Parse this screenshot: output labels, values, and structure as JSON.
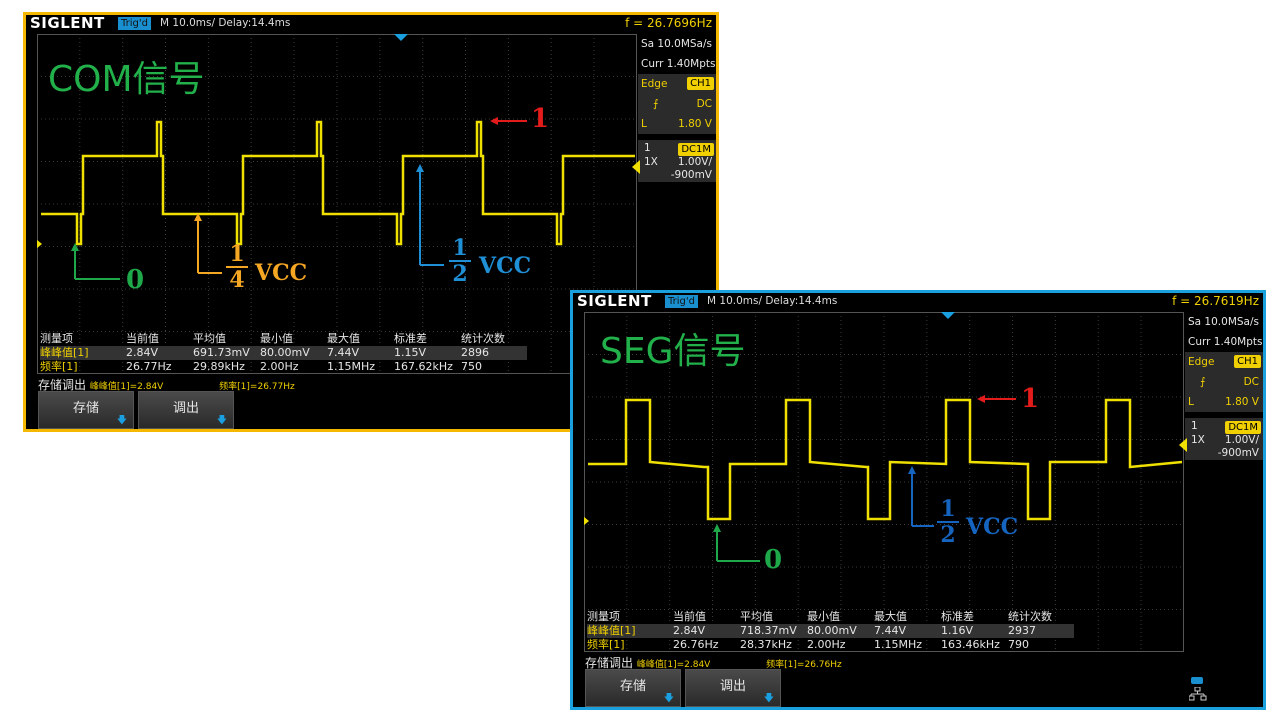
{
  "scopes": [
    {
      "logo": "SIGLENT",
      "trig_status": "Trig'd",
      "timebase": "M 10.0ms/ Delay:14.4ms",
      "frequency": "f = 26.7696Hz",
      "title": "COM信号",
      "panel": {
        "sample_rate": "Sa 10.0MSa/s",
        "curr": "Curr 1.40Mpts",
        "trigger_type": "Edge",
        "trigger_source": "CH1",
        "coupling": "DC",
        "level_label": "L",
        "level": "1.80 V",
        "channel": "1",
        "ch_coupling": "DC1M",
        "probe": "1X",
        "volts_div": "1.00V/",
        "offset": "-900mV"
      },
      "measurements": {
        "headers": [
          "测量项",
          "当前值",
          "平均值",
          "最小值",
          "最大值",
          "标准差",
          "统计次数"
        ],
        "rows": [
          [
            "峰峰值[1]",
            "2.84V",
            "691.73mV",
            "80.00mV",
            "7.44V",
            "1.15V",
            "2896"
          ],
          [
            "频率[1]",
            "26.77Hz",
            "29.89kHz",
            "2.00Hz",
            "1.15MHz",
            "167.62kHz",
            "750"
          ]
        ]
      },
      "save_label": "存储调出",
      "save_vpp": "峰峰值[1]=2.84V",
      "save_freq": "频率[1]=26.77Hz",
      "buttons": [
        "存储",
        "调出"
      ],
      "annotations": {
        "one": "1",
        "zero": "0",
        "quarter_num": "1",
        "quarter_den": "4",
        "half_num": "1",
        "half_den": "2",
        "vcc": "VCC"
      }
    },
    {
      "logo": "SIGLENT",
      "trig_status": "Trig'd",
      "timebase": "M 10.0ms/ Delay:14.4ms",
      "frequency": "f = 26.7619Hz",
      "title": "SEG信号",
      "panel": {
        "sample_rate": "Sa 10.0MSa/s",
        "curr": "Curr 1.40Mpts",
        "trigger_type": "Edge",
        "trigger_source": "CH1",
        "coupling": "DC",
        "level_label": "L",
        "level": "1.80 V",
        "channel": "1",
        "ch_coupling": "DC1M",
        "probe": "1X",
        "volts_div": "1.00V/",
        "offset": "-900mV"
      },
      "measurements": {
        "headers": [
          "测量项",
          "当前值",
          "平均值",
          "最小值",
          "最大值",
          "标准差",
          "统计次数"
        ],
        "rows": [
          [
            "峰峰值[1]",
            "2.84V",
            "718.37mV",
            "80.00mV",
            "7.44V",
            "1.16V",
            "2937"
          ],
          [
            "频率[1]",
            "26.76Hz",
            "28.37kHz",
            "2.00Hz",
            "1.15MHz",
            "163.46kHz",
            "790"
          ]
        ]
      },
      "save_label": "存储调出",
      "save_vpp": "峰峰值[1]=2.84V",
      "save_freq": "频率[1]=26.76Hz",
      "buttons": [
        "存储",
        "调出"
      ],
      "annotations": {
        "one": "1",
        "zero": "0",
        "half_num": "1",
        "half_den": "2",
        "vcc": "VCC"
      }
    }
  ],
  "colors": {
    "com_border": "#f5b800",
    "seg_border": "#1aa0dd",
    "trace": "#f0e000",
    "title": "#22b04a",
    "ann_red": "#e41b1b",
    "ann_green": "#1ea84a",
    "ann_orange": "#f5a623",
    "ann_blue": "#1f8fd6",
    "ann_blue2": "#1565c0"
  }
}
